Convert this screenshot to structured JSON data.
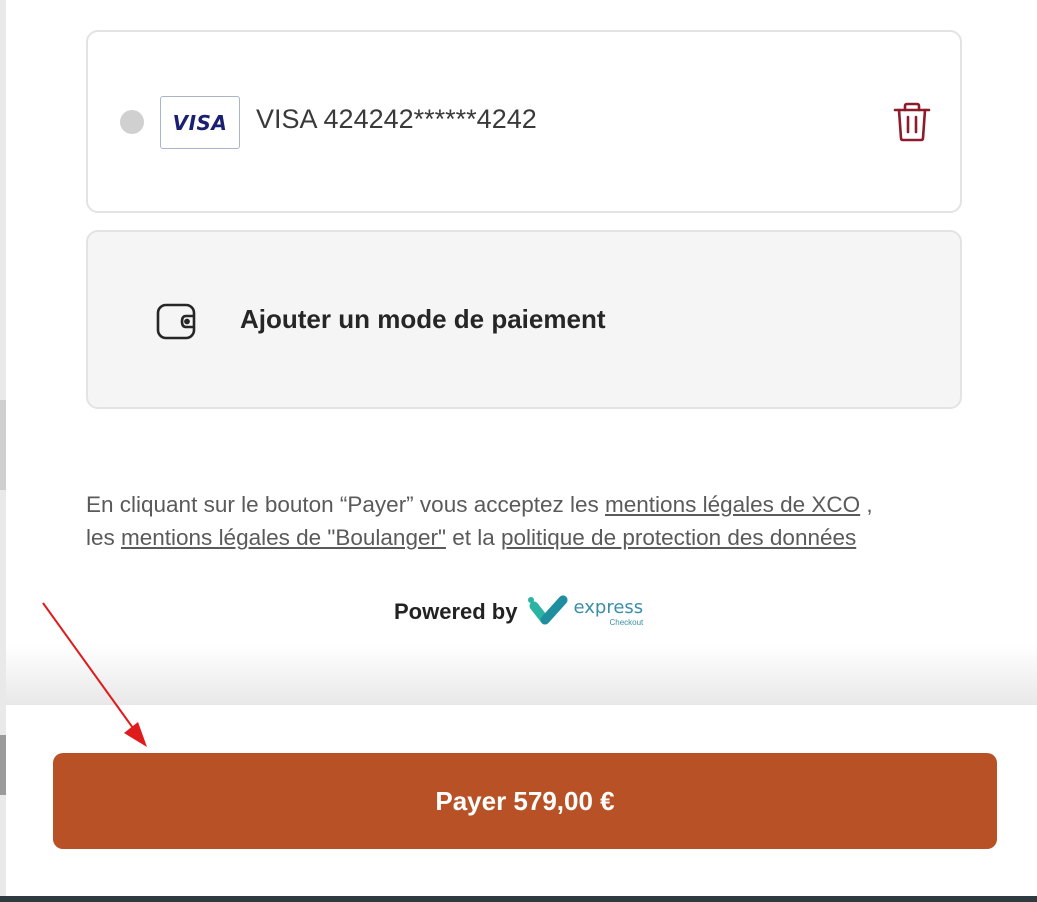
{
  "saved_card": {
    "brand_logo": "VISA",
    "number": "VISA 424242******4242",
    "selected": false
  },
  "add_payment": {
    "label": "Ajouter un mode de paiement"
  },
  "legal": {
    "part1": "En cliquant sur le bouton “Payer” vous acceptez les ",
    "link1": "mentions légales de XCO",
    "part2": " ,",
    "part3": "les ",
    "link2": "mentions légales de \"Boulanger\"",
    "part4": " et la ",
    "link3": "politique de protection des données"
  },
  "powered_by": {
    "text": "Powered by",
    "brand": "express",
    "brand_sub": "Checkout"
  },
  "pay_button": {
    "label": "Payer 579,00 €"
  },
  "colors": {
    "pay_button": "#b85226",
    "trash": "#8c1c2a",
    "visa_text": "#1a1f71",
    "brand_teal": "#3a8fa6",
    "annotation_arrow": "#e01b1b"
  },
  "icons": [
    "trash-icon",
    "wallet-icon",
    "express-checkout-logo",
    "annotation-arrow"
  ]
}
